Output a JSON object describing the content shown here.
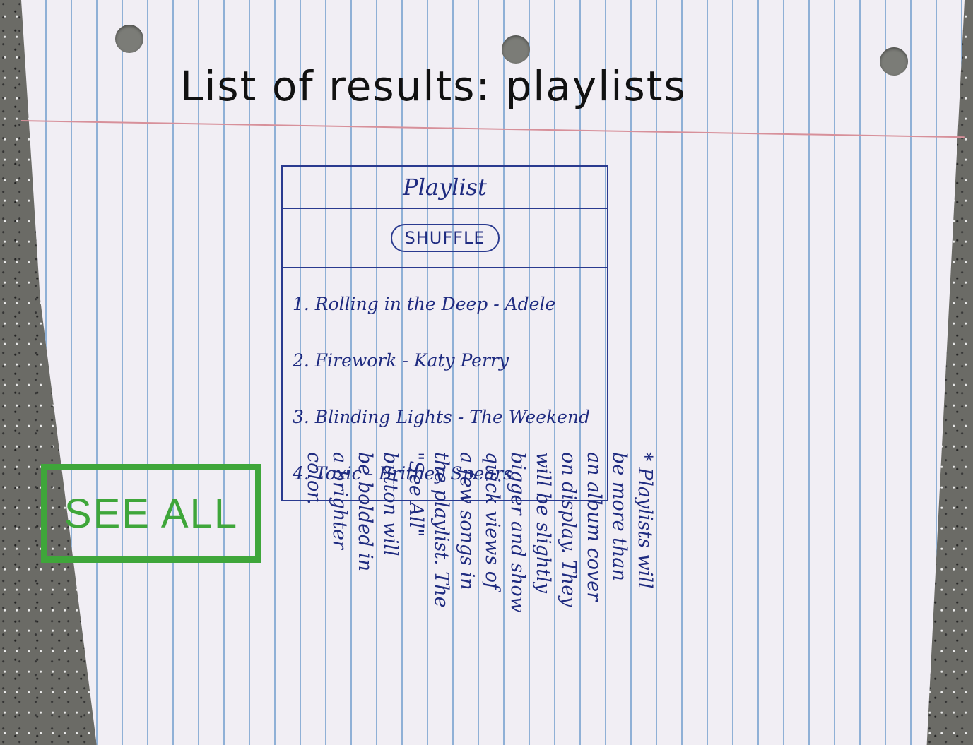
{
  "page": {
    "title": "List of results: playlists"
  },
  "playlist": {
    "header": "Playlist",
    "shuffle_label": "SHUFFLE",
    "songs": [
      "1. Rolling in the Deep - Adele",
      "2. Firework - Katy Perry",
      "3. Blinding Lights - The Weekend",
      "4. Toxic - Britney Spears"
    ]
  },
  "see_all_label": "SEE ALL",
  "note": {
    "lines": [
      "* Playlists will",
      "be more than",
      "an album cover",
      "on display. They",
      "will be slightly",
      "bigger and show",
      "quick views of",
      "a few songs in",
      "the playlist. The",
      "\"See All\"",
      "button will",
      "be bolded in",
      "a brighter",
      "color."
    ]
  },
  "colors": {
    "ink_blue": "#1f2b80",
    "marker_green": "#3fa63a",
    "paper": "#f1eef4"
  }
}
